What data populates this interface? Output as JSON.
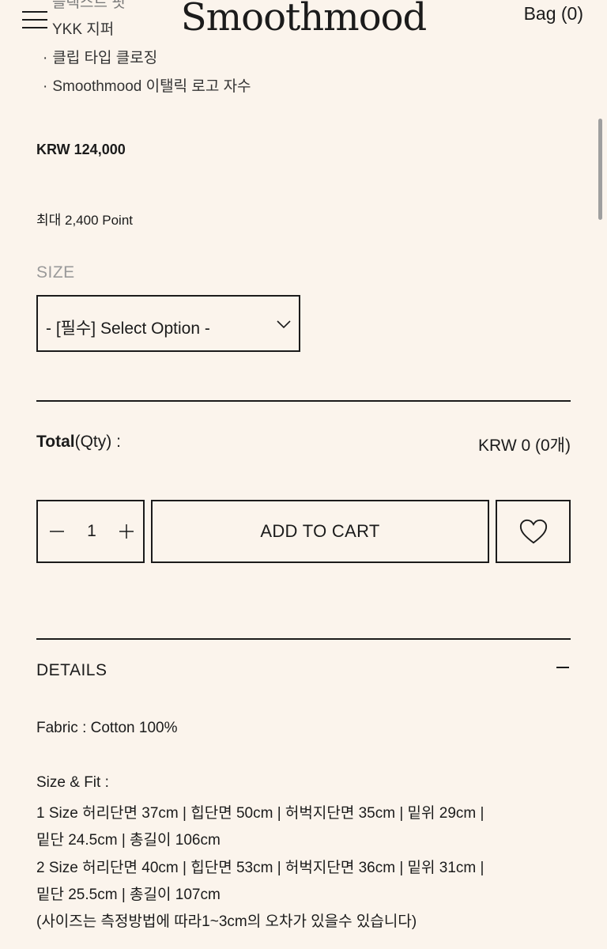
{
  "header": {
    "logo": "Smoothmood",
    "bag": "Bag (0)"
  },
  "features": {
    "partial_top": "블랙스트 핏",
    "items": [
      "YKK 지퍼",
      "클립 타입 클로징",
      "Smoothmood 이탤릭 로고 자수"
    ]
  },
  "product": {
    "price": "KRW 124,000",
    "point": "최대 2,400 Point"
  },
  "size": {
    "label": "SIZE",
    "select_value": "- [필수] Select Option -"
  },
  "total": {
    "label_bold": "Total",
    "label_rest": "(Qty) :",
    "value": "KRW 0 (0개)"
  },
  "cart": {
    "quantity": "1",
    "add_to_cart": "ADD TO CART"
  },
  "details": {
    "title": "DETAILS",
    "fabric": "Fabric : Cotton 100%",
    "size_fit_title": "Size & Fit :",
    "size_lines": [
      "1 Size 허리단면 37cm  |  힙단면 50cm  |  허벅지단면 35cm  |  밑위 29cm  |",
      "밑단 24.5cm  |  총길이 106cm",
      "2 Size 허리단면 40cm  |  힙단면 53cm  |  허벅지단면 36cm  |  밑위 31cm  |",
      "밑단 25.5cm  |  총길이 107cm",
      "(사이즈는 측정방법에 따라1~3cm의 오차가 있을수 있습니다)"
    ]
  },
  "icons": {
    "menu": "menu-icon",
    "chevron": "chevron-down-icon",
    "minus": "minus-icon",
    "plus": "plus-icon",
    "heart": "heart-icon",
    "collapse": "collapse-icon"
  }
}
